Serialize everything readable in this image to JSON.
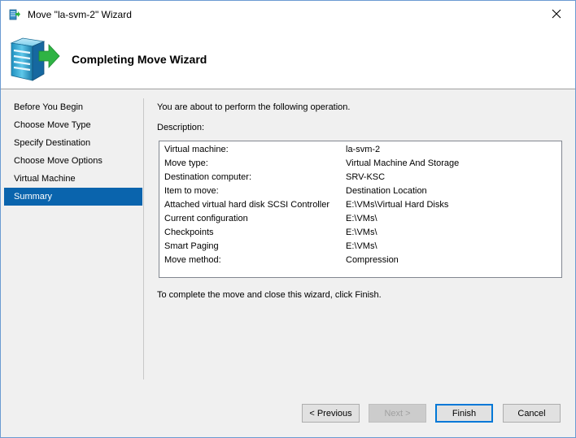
{
  "window": {
    "title": "Move \"la-svm-2\" Wizard"
  },
  "header": {
    "heading": "Completing Move Wizard"
  },
  "sidebar": {
    "items": [
      {
        "label": "Before You Begin",
        "active": false
      },
      {
        "label": "Choose Move Type",
        "active": false
      },
      {
        "label": "Specify Destination",
        "active": false
      },
      {
        "label": "Choose Move Options",
        "active": false
      },
      {
        "label": "Virtual Machine",
        "active": false
      },
      {
        "label": "Summary",
        "active": true
      }
    ]
  },
  "main": {
    "intro": "You are about to perform the following operation.",
    "description_label": "Description:",
    "summary": [
      {
        "key": "Virtual machine:",
        "value": "la-svm-2"
      },
      {
        "key": "Move type:",
        "value": "Virtual Machine And Storage"
      },
      {
        "key": "Destination computer:",
        "value": "SRV-KSC"
      },
      {
        "key": "Item to move:",
        "value": "Destination Location"
      },
      {
        "key": "Attached virtual hard disk  SCSI Controller",
        "value": "E:\\VMs\\Virtual Hard Disks"
      },
      {
        "key": "Current configuration",
        "value": "E:\\VMs\\"
      },
      {
        "key": "Checkpoints",
        "value": "E:\\VMs\\"
      },
      {
        "key": "Smart Paging",
        "value": "E:\\VMs\\"
      },
      {
        "key": "Move method:",
        "value": "Compression"
      }
    ],
    "outro": "To complete the move and close this wizard, click Finish."
  },
  "buttons": {
    "previous": "< Previous",
    "next": "Next >",
    "finish": "Finish",
    "cancel": "Cancel"
  },
  "icons": {
    "app": "hyperv-wizard-icon",
    "header": "server-move-icon",
    "close": "close-icon"
  },
  "colors": {
    "selection": "#0a64ad",
    "window_border": "#6b9bd2",
    "arrow_green": "#2fb344"
  }
}
